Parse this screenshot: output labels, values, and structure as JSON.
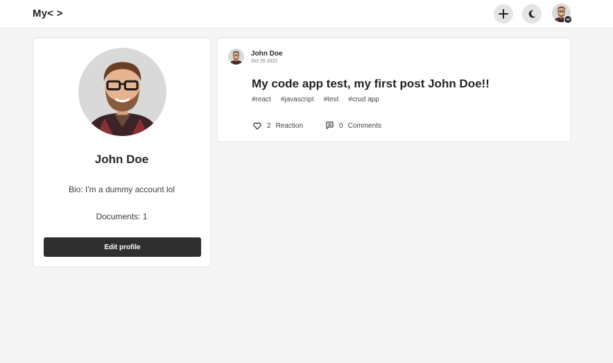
{
  "header": {
    "logo": "My< >",
    "icons": {
      "add": "plus-icon",
      "theme": "moon-icon",
      "menu": "chevron-down-icon"
    }
  },
  "profile": {
    "name": "John Doe",
    "bio": "Bio: I'm a dummy account lol",
    "documents": "Documents: 1",
    "edit_label": "Edit profile"
  },
  "post": {
    "author": "John Doe",
    "date": "Oct 25 2022",
    "title": "My code app test, my first post John Doe!!",
    "tags": [
      "#react",
      "#javascript",
      "#test",
      "#crud app"
    ],
    "reactions": {
      "count": "2",
      "label": "Reaction",
      "icon": "heart-icon"
    },
    "comments": {
      "count": "0",
      "label": "Comments",
      "icon": "comment-icon"
    }
  },
  "colors": {
    "background": "#f5f5f5",
    "card": "#ffffff",
    "button_dark": "#2f2f2f",
    "icon_button": "#e4e4e4"
  }
}
